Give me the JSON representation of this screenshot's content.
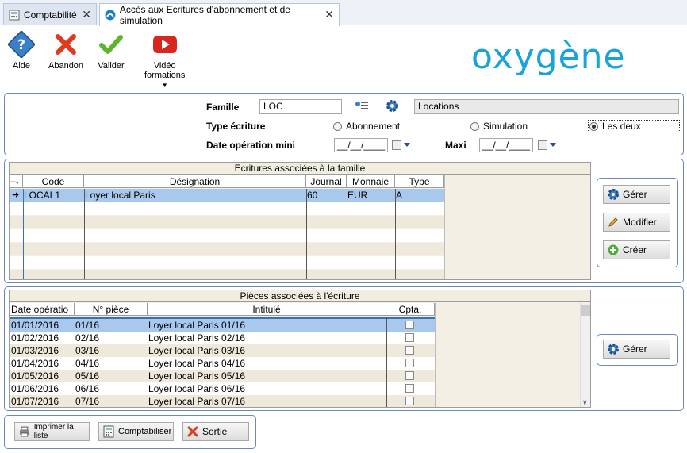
{
  "tabs": [
    {
      "label": "Comptabilité",
      "active": false
    },
    {
      "label": "Accès aux Ecritures d'abonnement et de simulation",
      "active": true
    }
  ],
  "toolbar": {
    "aide": "Aide",
    "abandon": "Abandon",
    "valider": "Valider",
    "video_1": "Vidéo",
    "video_2": "formations"
  },
  "logo": "oxygène",
  "form": {
    "famille_label": "Famille",
    "famille_code": "LOC",
    "famille_name": "Locations",
    "type_label": "Type écriture",
    "radio_abonnement": "Abonnement",
    "radio_simulation": "Simulation",
    "radio_les_deux": "Les deux",
    "selected": "Les deux",
    "date_min_label": "Date opération mini",
    "date_min_value": "__/__/____",
    "maxi_label": "Maxi",
    "date_max_value": "__/__/____"
  },
  "ecritures": {
    "title": "Ecritures associées à la famille",
    "columns": [
      "Code",
      "Désignation",
      "Journal",
      "Monnaie",
      "Type"
    ],
    "rows": [
      {
        "code": "LOCAL1",
        "designation": "Loyer local Paris",
        "journal": "60",
        "monnaie": "EUR",
        "type": "A"
      }
    ],
    "buttons": {
      "gerer": "Gérer",
      "modifier": "Modifier",
      "creer": "Créer"
    }
  },
  "pieces": {
    "title": "Pièces associées à l'écriture",
    "columns": [
      "Date opératio",
      "N° pièce",
      "Intitulé",
      "Cpta."
    ],
    "rows": [
      {
        "date": "01/01/2016",
        "piece": "01/16",
        "intitule": "Loyer local Paris 01/16"
      },
      {
        "date": "01/02/2016",
        "piece": "02/16",
        "intitule": "Loyer local Paris 02/16"
      },
      {
        "date": "01/03/2016",
        "piece": "03/16",
        "intitule": "Loyer local Paris 03/16"
      },
      {
        "date": "01/04/2016",
        "piece": "04/16",
        "intitule": "Loyer local Paris 04/16"
      },
      {
        "date": "01/05/2016",
        "piece": "05/16",
        "intitule": "Loyer local Paris 05/16"
      },
      {
        "date": "01/06/2016",
        "piece": "06/16",
        "intitule": "Loyer local Paris 06/16"
      },
      {
        "date": "01/07/2016",
        "piece": "07/16",
        "intitule": "Loyer local Paris 07/16"
      }
    ],
    "buttons": {
      "gerer": "Gérer"
    }
  },
  "footer": {
    "imprimer": "Imprimer la liste",
    "comptabiliser": "Comptabiliser",
    "sortie": "Sortie"
  },
  "colors": {
    "selection": "#a9c8ee",
    "accent": "#1aa3d9",
    "panel_border": "#6b89b6"
  }
}
